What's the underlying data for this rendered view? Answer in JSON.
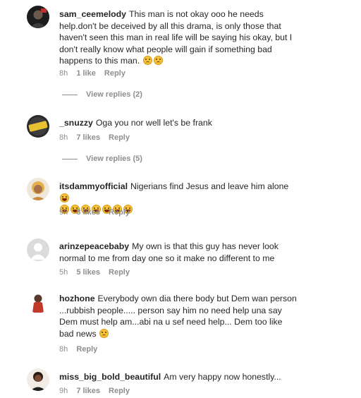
{
  "comments": [
    {
      "username": "sam_ceemelody",
      "text": "This man is not okay ooo he needs help.don't be deceived by all this drama, is only those that haven't seen this man in real life will be saying his okay, but I don't really know what people will gain if something bad happens to this man.",
      "emoji_after": "😢😢",
      "time": "8h",
      "likes": "1 like",
      "reply": "Reply",
      "view_replies": "View replies (2)"
    },
    {
      "username": "_snuzzy",
      "text": "Oga you nor well let's be frank",
      "time": "8h",
      "likes": "7 likes",
      "reply": "Reply",
      "view_replies": "View replies (5)"
    },
    {
      "username": "itsdammyofficial",
      "text": "Nigerians find Jesus and leave him alone",
      "emoji_after": "😂😂😂😂😂😂😂😂",
      "time": "9h",
      "likes": "8 likes",
      "reply": "Reply"
    },
    {
      "username": "arinzepeacebaby",
      "text": "My own is that this guy has never look normal to me from day one so it make no different to me",
      "time": "5h",
      "likes": "5 likes",
      "reply": "Reply"
    },
    {
      "username": "hozhone",
      "text": "Everybody own dia there body but Dem wan person ...rubbish people..... person say him no need help una say Dem must help am...abi na u sef need help... Dem too like bad news",
      "emoji_after": "😢",
      "time": "8h",
      "reply": "Reply"
    },
    {
      "username": "miss_big_bold_beautiful",
      "text": "Am very happy now honestly...",
      "time": "9h",
      "likes": "7 likes",
      "reply": "Reply"
    }
  ],
  "colors": {
    "text": "#262626",
    "muted": "#8e8e8e",
    "emoji": "#f6c23a"
  },
  "icons": [
    "emoji-sad-icon",
    "emoji-laugh-icon"
  ]
}
